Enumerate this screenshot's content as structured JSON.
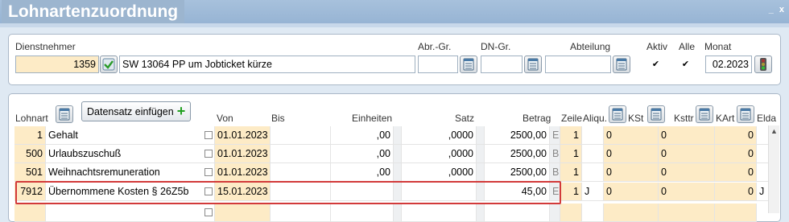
{
  "window": {
    "title": "Lohnartenzuordnung",
    "controls": "_ x"
  },
  "filter": {
    "dienstnehmer_label": "Dienstnehmer",
    "dienstnehmer_number": "1359",
    "dienstnehmer_name": "SW 13064 PP um Jobticket kürze",
    "abrgr_label": "Abr.-Gr.",
    "dngr_label": "DN-Gr.",
    "abteilung_label": "Abteilung",
    "aktiv_label": "Aktiv",
    "alle_label": "Alle",
    "monat_label": "Monat",
    "monat_value": "02.2023"
  },
  "grid": {
    "insert_button": "Datensatz einfügen",
    "headers": {
      "lohnart": "Lohnart",
      "von": "Von",
      "bis": "Bis",
      "einheiten": "Einheiten",
      "satz": "Satz",
      "betrag": "Betrag",
      "zeile": "Zeile",
      "aliqu": "Aliqu.",
      "kst": "KSt",
      "ksttr": "Ksttr",
      "kart": "KArt",
      "elda": "Elda"
    },
    "rows": [
      {
        "lohnart": "1",
        "name": "Gehalt",
        "von": "01.01.2023",
        "bis": "",
        "einheiten": ",00",
        "satz": ",0000",
        "betrag": "2500,00",
        "flag": "E",
        "zeile": "1",
        "aliqu": "",
        "kst": "0",
        "ksttr": "0",
        "kart": "0",
        "elda": ""
      },
      {
        "lohnart": "500",
        "name": "Urlaubszuschuß",
        "von": "01.01.2023",
        "bis": "",
        "einheiten": ",00",
        "satz": ",0000",
        "betrag": "2500,00",
        "flag": "B",
        "zeile": "1",
        "aliqu": "",
        "kst": "0",
        "ksttr": "0",
        "kart": "0",
        "elda": ""
      },
      {
        "lohnart": "501",
        "name": "Weihnachtsremuneration",
        "von": "01.01.2023",
        "bis": "",
        "einheiten": ",00",
        "satz": ",0000",
        "betrag": "2500,00",
        "flag": "B",
        "zeile": "1",
        "aliqu": "",
        "kst": "0",
        "ksttr": "0",
        "kart": "0",
        "elda": ""
      },
      {
        "lohnart": "7912",
        "name": "Übernommene Kosten § 26Z5b",
        "von": "15.01.2023",
        "bis": "",
        "einheiten": "",
        "satz": "",
        "betrag": "45,00",
        "flag": "E",
        "zeile": "1",
        "aliqu": "J",
        "kst": "0",
        "ksttr": "0",
        "kart": "0",
        "elda": "J"
      }
    ]
  }
}
